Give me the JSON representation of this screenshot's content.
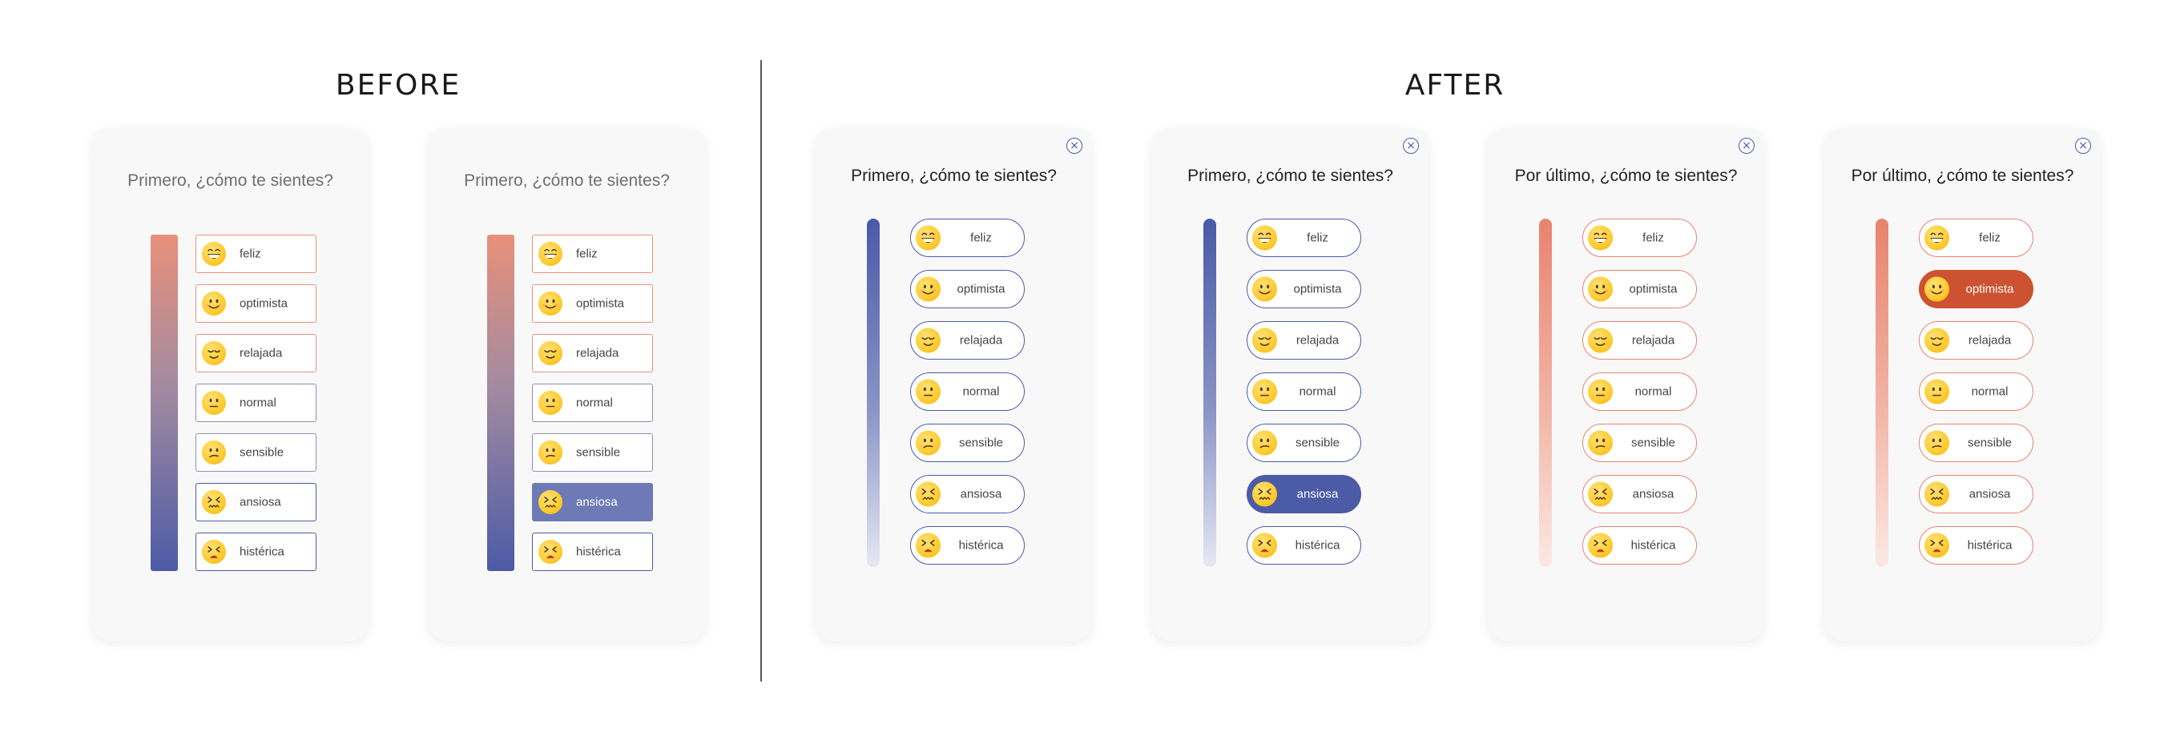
{
  "headings": {
    "before": "BEFORE",
    "after": "AFTER"
  },
  "colors": {
    "blue": "#4a5aa8",
    "coral": "#e8836e",
    "selected_blue": "#4c5ba6",
    "selected_old_blue": "#6e7ab6",
    "selected_orange": "#cc5232"
  },
  "moods": [
    {
      "label": "feliz",
      "icon": "grinning-face-icon"
    },
    {
      "label": "optimista",
      "icon": "smiling-face-icon"
    },
    {
      "label": "relajada",
      "icon": "relieved-face-icon"
    },
    {
      "label": "normal",
      "icon": "neutral-face-icon"
    },
    {
      "label": "sensible",
      "icon": "confused-face-icon"
    },
    {
      "label": "ansiosa",
      "icon": "confounded-face-icon"
    },
    {
      "label": "histérica",
      "icon": "angry-face-icon"
    }
  ],
  "cards": [
    {
      "question": "Primero, ¿cómo te sientes?",
      "selected": null
    },
    {
      "question": "Primero, ¿cómo te sientes?",
      "selected": "ansiosa"
    },
    {
      "question": "Primero, ¿cómo te sientes?",
      "selected": null,
      "close_label": "×"
    },
    {
      "question": "Primero, ¿cómo te sientes?",
      "selected": "ansiosa",
      "close_label": "×"
    },
    {
      "question": "Por último, ¿cómo te sientes?",
      "selected": null,
      "close_label": "×"
    },
    {
      "question": "Por último, ¿cómo te sientes?",
      "selected": "optimista",
      "close_label": "×"
    }
  ]
}
